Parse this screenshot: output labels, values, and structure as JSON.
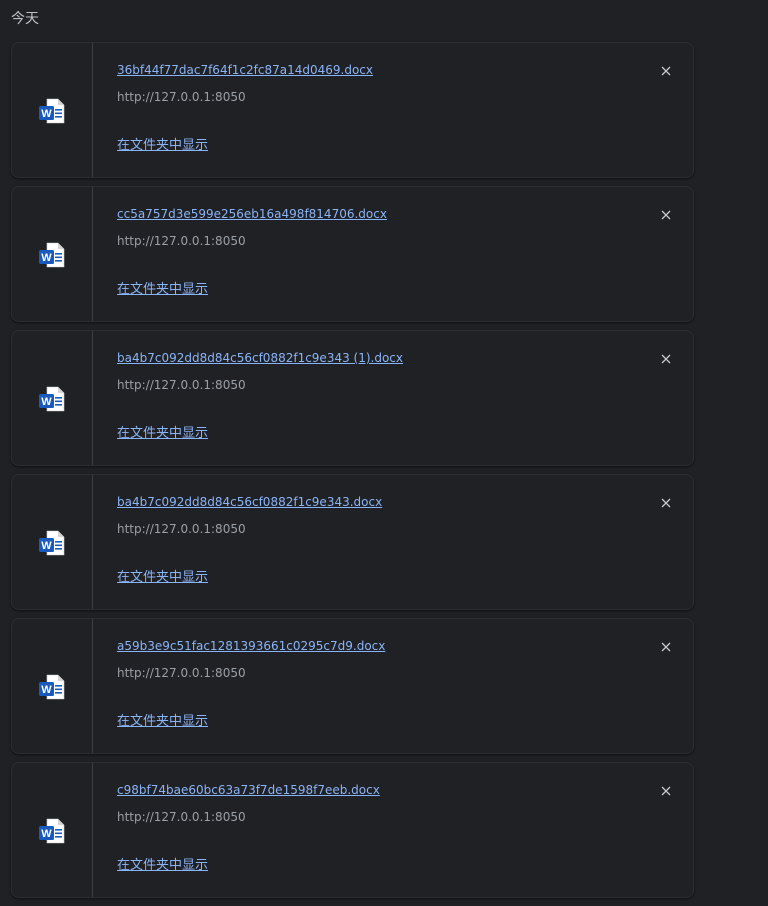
{
  "section": {
    "header": "今天"
  },
  "downloads": [
    {
      "filename": "36bf44f77dac7f64f1c2fc87a14d0469.docx",
      "url": "http://127.0.0.1:8050",
      "action": "在文件夹中显示",
      "icon": "word-doc-icon"
    },
    {
      "filename": "cc5a757d3e599e256eb16a498f814706.docx",
      "url": "http://127.0.0.1:8050",
      "action": "在文件夹中显示",
      "icon": "word-doc-icon"
    },
    {
      "filename": "ba4b7c092dd8d84c56cf0882f1c9e343 (1).docx",
      "url": "http://127.0.0.1:8050",
      "action": "在文件夹中显示",
      "icon": "word-doc-icon"
    },
    {
      "filename": "ba4b7c092dd8d84c56cf0882f1c9e343.docx",
      "url": "http://127.0.0.1:8050",
      "action": "在文件夹中显示",
      "icon": "word-doc-icon"
    },
    {
      "filename": "a59b3e9c51fac1281393661c0295c7d9.docx",
      "url": "http://127.0.0.1:8050",
      "action": "在文件夹中显示",
      "icon": "word-doc-icon"
    },
    {
      "filename": "c98bf74bae60bc63a73f7de1598f7eeb.docx",
      "url": "http://127.0.0.1:8050",
      "action": "在文件夹中显示",
      "icon": "word-doc-icon"
    }
  ],
  "colors": {
    "background": "#202124",
    "link": "#8ab4f8",
    "secondary_text": "#9aa0a6",
    "word_blue": "#185abd"
  }
}
